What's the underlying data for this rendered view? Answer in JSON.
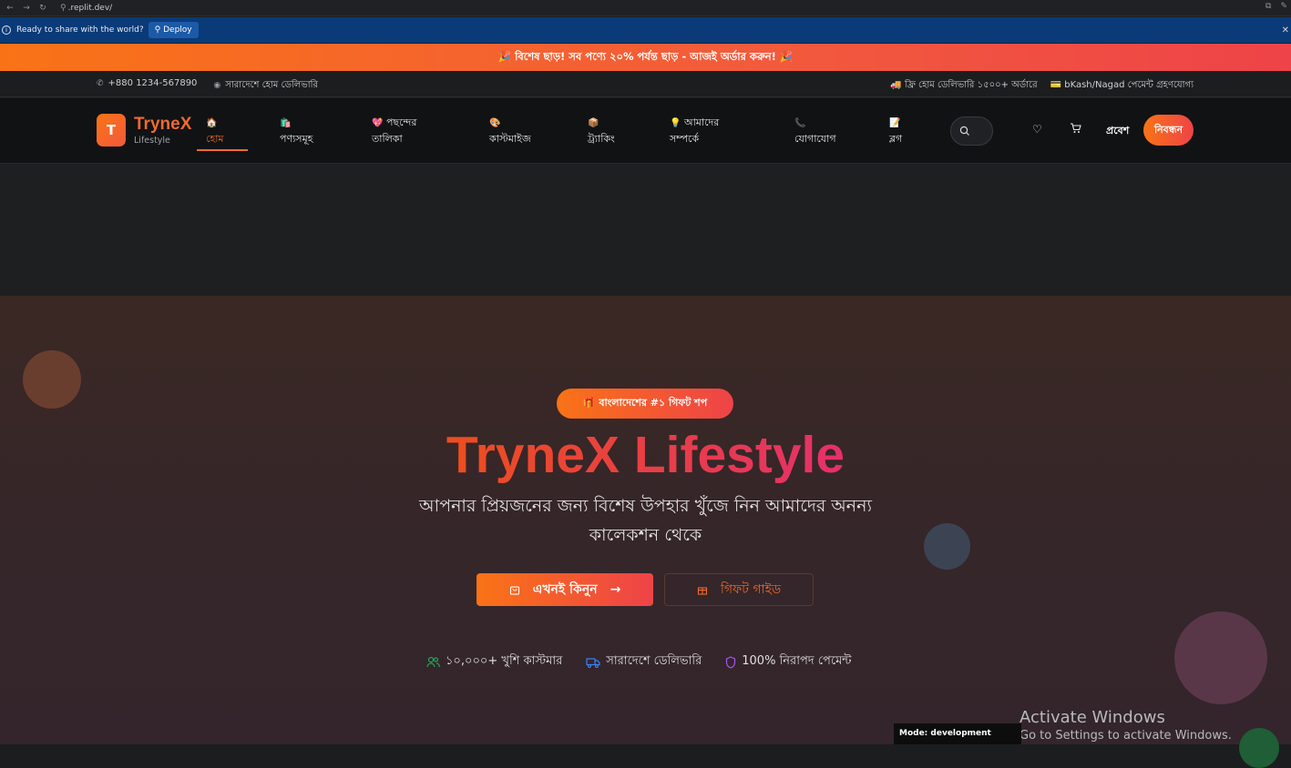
{
  "browser": {
    "url": ".replit.dev/"
  },
  "replit_banner": {
    "message": "Ready to share with the world?",
    "deploy_label": "Deploy"
  },
  "promo": {
    "text": "🎉 বিশেষ ছাড়! সব পণ্যে ২০% পর্যন্ত ছাড় - আজই অর্ডার করুন! 🎉"
  },
  "info_strip": {
    "phone": "+880 1234-567890",
    "location": "সারাদেশে হোম ডেলিভারি",
    "free_delivery": "🚚 ফ্রি হোম ডেলিভারি ১৫০০+ অর্ডারে",
    "payment": "💳 bKash/Nagad পেমেন্ট গ্রহণযোগ্য"
  },
  "header": {
    "logo_letter": "T",
    "brand": "TryneX",
    "tagline": "Lifestyle",
    "nav": [
      {
        "icon": "🏠",
        "label": "হোম"
      },
      {
        "icon": "🛍️",
        "label": "পণ্যসমূহ"
      },
      {
        "icon": "💖",
        "label_line1": "পছন্দের",
        "label_line2": "তালিকা"
      },
      {
        "icon": "🎨",
        "label": "কাস্টমাইজ"
      },
      {
        "icon": "📦",
        "label": "ট্র্যাকিং"
      },
      {
        "icon": "💡",
        "label_line1": "আমাদের",
        "label_line2": "সম্পর্কে"
      },
      {
        "icon": "📞",
        "label": "যোগাযোগ"
      },
      {
        "icon": "📝",
        "label": "ব্লগ"
      }
    ],
    "login_label": "প্রবেশ",
    "signup_label": "নিবন্ধন"
  },
  "hero": {
    "badge": "🎁 বাংলাদেশের #১ গিফট শপ",
    "title": "TryneX Lifestyle",
    "subtitle_line1": "আপনার প্রিয়জনের জন্য বিশেষ উপহার খুঁজে নিন আমাদের অনন্য",
    "subtitle_line2": "কালেকশন থেকে",
    "primary_button": "এখনই কিনুন",
    "secondary_button": "গিফট গাইড",
    "features": [
      "১০,০০০+ খুশি কাস্টমার",
      "সারাদেশে ডেলিভারি",
      "100% নিরাপদ পেমেন্ট"
    ]
  },
  "overlays": {
    "activate_title": "Activate Windows",
    "activate_sub": "Go to Settings to activate Windows.",
    "mode": "Mode: development"
  },
  "colors": {
    "accent": "#f26a2c",
    "gradient_start": "#f97316",
    "gradient_end": "#ee4348",
    "replit_blue": "#0a3a78"
  }
}
